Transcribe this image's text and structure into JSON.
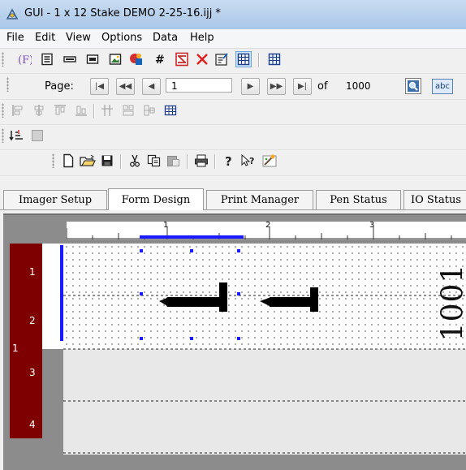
{
  "window": {
    "title": "GUI - 1 x 12 Stake DEMO 2-25-16.ijj *"
  },
  "menu": [
    "File",
    "Edit",
    "View",
    "Options",
    "Data",
    "Help"
  ],
  "toolbar1": {
    "icons": [
      "formula-icon",
      "text-lines-icon",
      "barcode-line-icon",
      "field-icon",
      "image-icon",
      "graphic-icon",
      "hash-icon",
      "pdf-icon",
      "delete-icon",
      "properties-icon",
      "grid-icon",
      "table-icon"
    ]
  },
  "pager": {
    "label": "Page:",
    "first": "|◀",
    "prev_many": "◀◀",
    "prev": "◀",
    "current_page": "1",
    "next": "▶",
    "next_many": "▶▶",
    "last": "▶|",
    "of_label": "of",
    "total_pages": "1000",
    "abc_label": "abc"
  },
  "toolbar3": {
    "icons": [
      "align-left-icon",
      "align-center-icon",
      "align-top-icon",
      "align-bottom-icon",
      "distribute-icon",
      "same-size-icon",
      "center-icon",
      "table-insert-icon"
    ]
  },
  "toolbar4": {
    "icons": [
      "sort-icon",
      "box-icon"
    ]
  },
  "toolbar5": {
    "icons": [
      "new-icon",
      "open-icon",
      "save-icon",
      "cut-icon",
      "copy-icon",
      "paste-icon",
      "print-icon",
      "help-icon",
      "context-help-icon",
      "wizard-icon"
    ]
  },
  "tabs": [
    "Imager Setup",
    "Form Design",
    "Print Manager",
    "Pen Status",
    "IO Status"
  ],
  "active_tab": "Form Design",
  "design": {
    "ruler_top_marks": [
      "1",
      "2",
      "3"
    ],
    "ruler_left_marks": [
      "1",
      "2",
      "3",
      "4"
    ],
    "side_marker": "1",
    "label_text": "1001",
    "colors": {
      "ruler_left_bg": "#7f0000",
      "selection": "#1a1aff",
      "canvas_bg": "#e8e8e8"
    }
  }
}
